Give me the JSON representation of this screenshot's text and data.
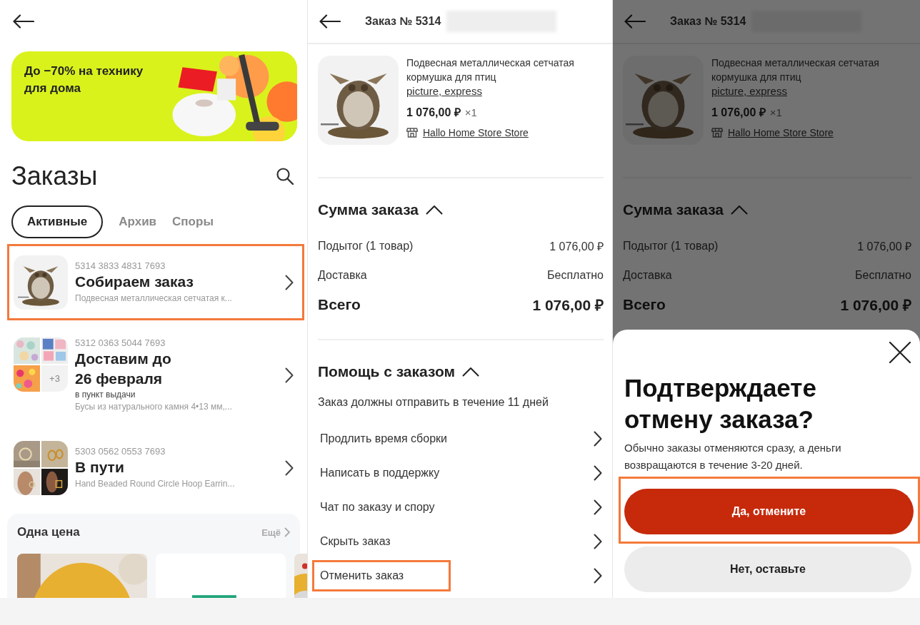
{
  "screens": [
    {
      "kind": "orders",
      "banner": {
        "text": "До −70% на технику для дома"
      },
      "title": "Заказы",
      "tabs": [
        {
          "label": "Активные",
          "selected": true
        },
        {
          "label": "Архив",
          "selected": false
        },
        {
          "label": "Споры",
          "selected": false
        }
      ],
      "orders": [
        {
          "number": "5314 3833 4831 7693",
          "status": "Собираем заказ",
          "item": "Подвесная металлическая сетчатая к...",
          "highlighted": true
        },
        {
          "number": "5312 0363 5044 7693",
          "status": "Доставим до\n26 февраля",
          "note": "в пункт выдачи",
          "item": "Бусы из натурального камня 4•13 мм,...",
          "more_count": "+3",
          "highlighted": false
        },
        {
          "number": "5303 0562 0553 7693",
          "status": "В пути",
          "item": "Hand Beaded Round Circle Hoop Earrin...",
          "highlighted": false
        }
      ],
      "recommendations": {
        "title": "Одна цена",
        "more": "Ещё"
      }
    },
    {
      "kind": "order_detail",
      "dimmed": false,
      "header": {
        "title": "Заказ № 5314",
        "number_hidden": true
      },
      "product": {
        "title": "Подвесная металлическая сетчатая кормушка для птиц",
        "variant": "picture, express",
        "price": "1 076,00 ₽",
        "quantity": "×1",
        "store": "Hallo Home Store Store"
      },
      "summary": {
        "title": "Сумма заказа",
        "expanded": true,
        "rows": [
          {
            "label": "Подытог (1 товар)",
            "value": "1 076,00 ₽",
            "total": false
          },
          {
            "label": "Доставка",
            "value": "Бесплатно",
            "total": false
          },
          {
            "label": "Всего",
            "value": "1 076,00 ₽",
            "total": true
          }
        ]
      },
      "help": {
        "title": "Помощь с заказом",
        "expanded": true,
        "note": "Заказ должны отправить в течение 11 дней",
        "links": [
          {
            "label": "Продлить время сборки",
            "highlighted": false
          },
          {
            "label": "Написать в поддержку",
            "highlighted": false
          },
          {
            "label": "Чат по заказу и спору",
            "highlighted": false
          },
          {
            "label": "Скрыть заказ",
            "highlighted": false
          },
          {
            "label": "Отменить заказ",
            "highlighted": true
          }
        ]
      }
    },
    {
      "kind": "order_detail",
      "dimmed": true,
      "header": {
        "title": "Заказ № 5314",
        "number_hidden": true
      },
      "product": {
        "title": "Подвесная металлическая сетчатая кормушка для птиц",
        "variant": "picture, express",
        "price": "1 076,00 ₽",
        "quantity": "×1",
        "store": "Hallo Home Store Store"
      },
      "summary": {
        "title": "Сумма заказа",
        "expanded": true,
        "rows": [
          {
            "label": "Подытог (1 товар)",
            "value": "1 076,00 ₽",
            "total": false
          },
          {
            "label": "Доставка",
            "value": "Бесплатно",
            "total": false
          },
          {
            "label": "Всего",
            "value": "1 076,00 ₽",
            "total": true
          }
        ]
      },
      "dialog": {
        "title": "Подтверждаете отмену заказа?",
        "text": "Обычно заказы отменяются сразу, а деньги возвращаются в течение 3-20 дней.",
        "buttons": [
          {
            "label": "Да, отмените",
            "kind": "primary",
            "highlighted": true
          },
          {
            "label": "Нет, оставьте",
            "kind": "secondary",
            "highlighted": false
          }
        ]
      }
    }
  ]
}
